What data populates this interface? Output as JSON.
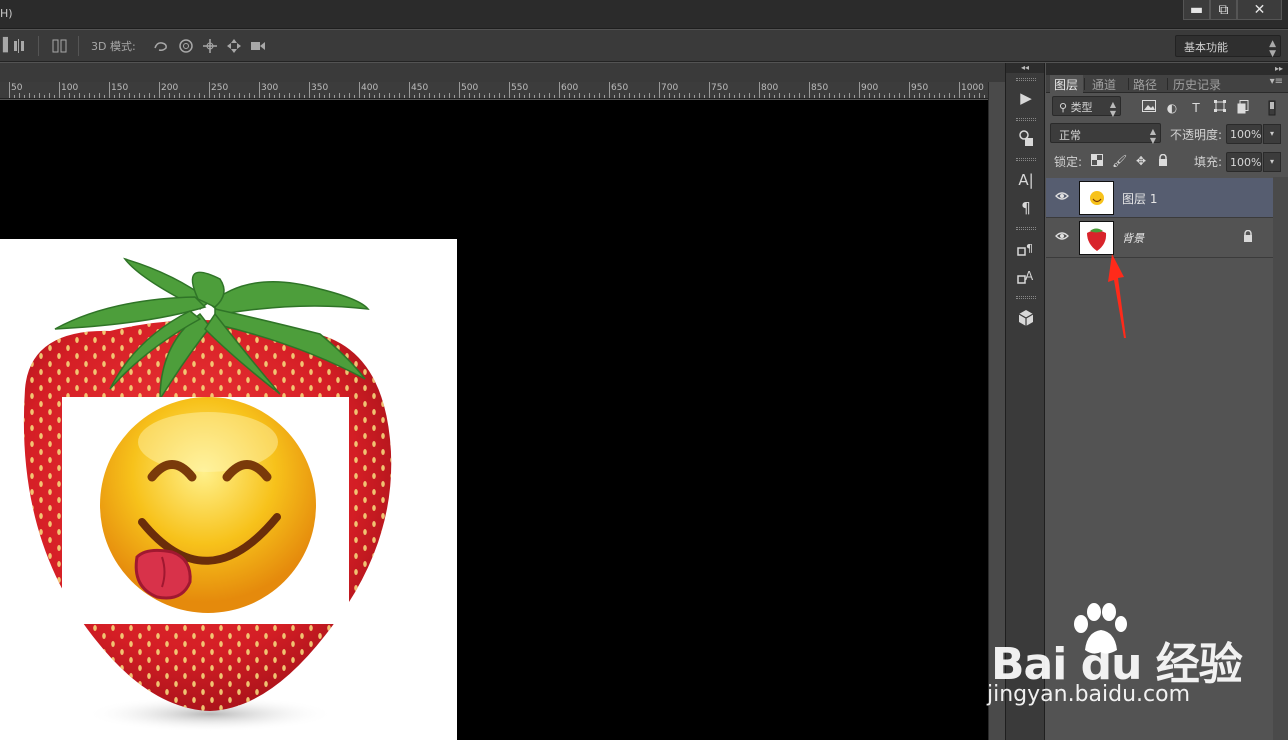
{
  "menubar": {
    "menu_fragment": "H)"
  },
  "window_controls": {
    "minimize": "▬",
    "restore": "⧉",
    "close": "✕"
  },
  "options_bar": {
    "mode_label": "3D 模式:",
    "workspace": "基本功能"
  },
  "ruler": {
    "labels": [
      "50",
      "100",
      "150",
      "200",
      "250",
      "300",
      "350",
      "400",
      "450",
      "500",
      "550",
      "600",
      "650",
      "700",
      "750",
      "800",
      "850",
      "900",
      "950",
      "1000"
    ]
  },
  "panel_strip": {
    "collapse_glyph": "◂◂"
  },
  "layers_panel": {
    "expand_glyph": "▸▸",
    "tabs": [
      "图层",
      "通道",
      "路径",
      "历史记录"
    ],
    "filter": {
      "label": "类型"
    },
    "blend_mode": "正常",
    "opacity_label": "不透明度:",
    "opacity_value": "100%",
    "lock_label": "锁定:",
    "fill_label": "填充:",
    "fill_value": "100%",
    "layers": [
      {
        "name": "图层 1",
        "selected": true,
        "locked": false
      },
      {
        "name": "背景",
        "selected": false,
        "locked": true
      }
    ]
  },
  "annotation": {
    "arrow_color": "#ff2a1a"
  },
  "watermark": {
    "main": "Bai du 经验",
    "sub": "jingyan.baidu.com"
  },
  "colors": {
    "canvas": "#000000",
    "panel": "#535353",
    "selected_layer": "#565d70",
    "strawberry": "#d8242b",
    "leaf": "#4a9c3a",
    "emoji": "#f7c21b"
  }
}
